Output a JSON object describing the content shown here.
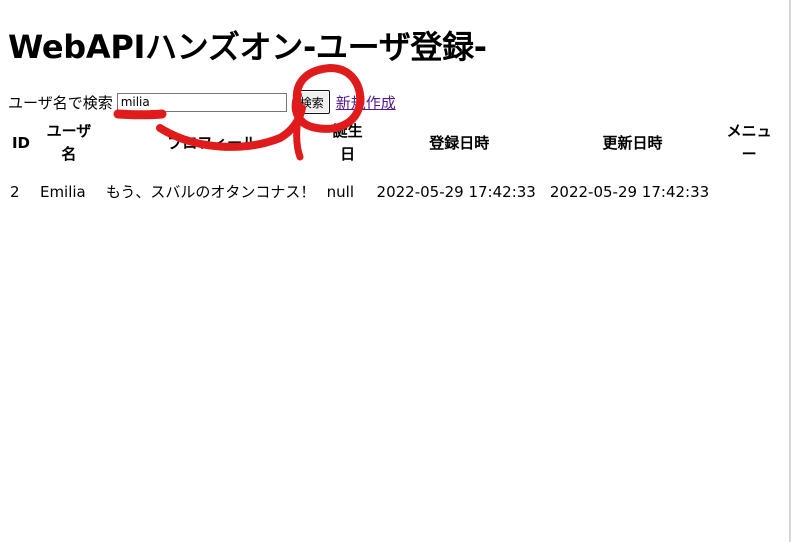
{
  "page": {
    "title": "WebAPIハンズオン-ユーザ登録-"
  },
  "search": {
    "label": "ユーザ名で検索",
    "value": "milia",
    "button_label": "検索"
  },
  "actions": {
    "new_link_label": "新規作成"
  },
  "table": {
    "headers": [
      "ID",
      "ユーザ名",
      "プロフィール",
      "誕生日",
      "登録日時",
      "更新日時",
      "メニュー"
    ],
    "rows": [
      [
        "2",
        "Emilia",
        "もう、スバルのオタンコナス！",
        "null",
        "2022-05-29 17:42:33",
        "2022-05-29 17:42:33",
        ""
      ]
    ]
  },
  "annotation": {
    "color": "#e01b1b"
  }
}
